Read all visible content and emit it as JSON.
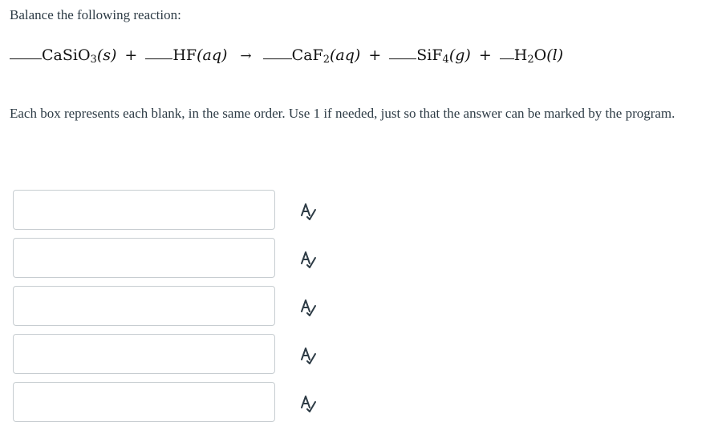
{
  "question": {
    "prompt": "Balance the following reaction:",
    "instructions": "Each box represents each blank, in the same order. Use 1 if needed, just so that the answer can be marked by the program."
  },
  "equation": {
    "arrow": "→",
    "plus": "+",
    "reactants": [
      {
        "formula_main": "CaSiO",
        "formula_sub": "3",
        "formula_tail": "",
        "state": "(s)"
      },
      {
        "formula_main": "HF",
        "formula_sub": "",
        "formula_tail": "",
        "state": "(aq)"
      }
    ],
    "products": [
      {
        "formula_main": "CaF",
        "formula_sub": "2",
        "formula_tail": "",
        "state": "(aq)"
      },
      {
        "formula_main": "SiF",
        "formula_sub": "4",
        "formula_tail": "",
        "state": "(g)"
      },
      {
        "formula_main": "H",
        "formula_sub": "2",
        "formula_tail": "O",
        "state": "(l)"
      }
    ]
  },
  "answers": [
    {
      "value": "",
      "placeholder": "",
      "icon": "spellcheck-icon"
    },
    {
      "value": "",
      "placeholder": "",
      "icon": "spellcheck-icon"
    },
    {
      "value": "",
      "placeholder": "",
      "icon": "spellcheck-icon"
    },
    {
      "value": "",
      "placeholder": "",
      "icon": "spellcheck-icon"
    },
    {
      "value": "",
      "placeholder": "",
      "icon": "spellcheck-icon"
    }
  ],
  "colors": {
    "text": "#2d3b45",
    "input_border": "#c7cdd1",
    "icon": "#2d3b45"
  }
}
